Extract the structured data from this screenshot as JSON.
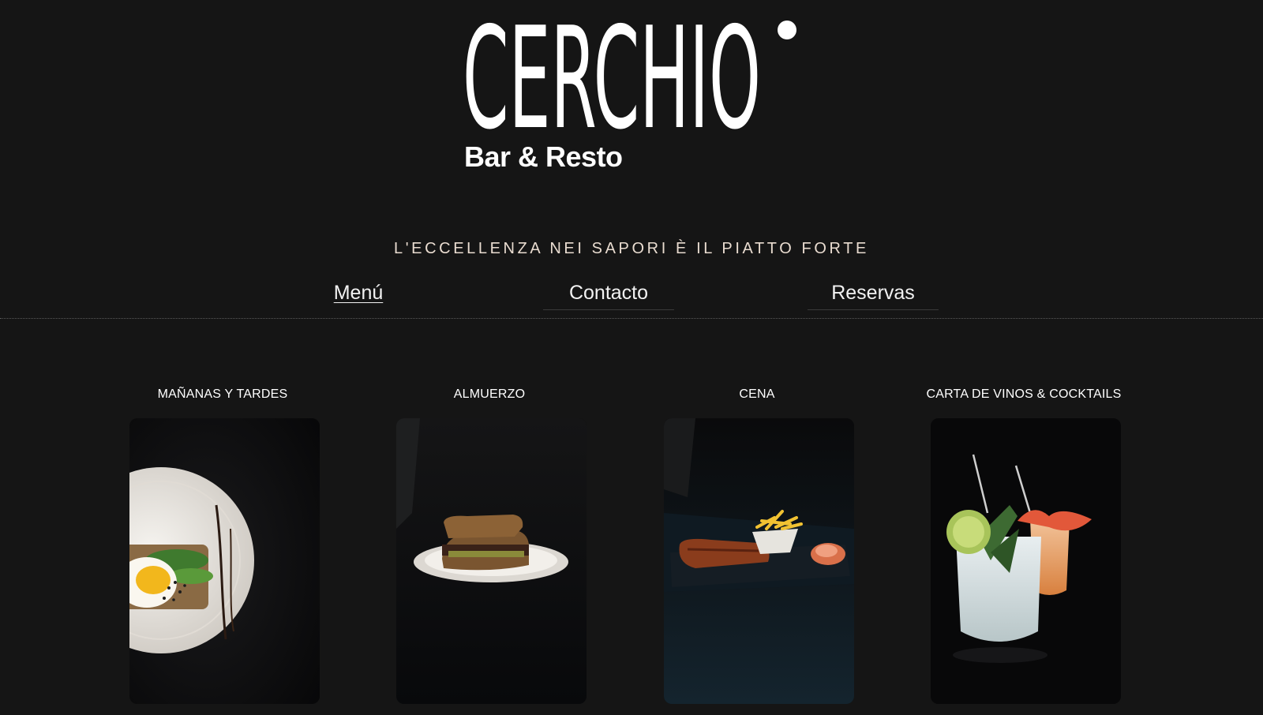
{
  "brand": {
    "name": "CERCHIO",
    "subtitle": "Bar & Resto"
  },
  "tagline": "L'ECCELLENZA NEI SAPORI È IL PIATTO FORTE",
  "nav": {
    "menu": "Menú",
    "contacto": "Contacto",
    "reservas": "Reservas"
  },
  "cards": [
    {
      "title": "MAÑANAS Y TARDES",
      "image": "egg-avocado-toast-photo"
    },
    {
      "title": "ALMUERZO",
      "image": "sandwich-photo"
    },
    {
      "title": "CENA",
      "image": "ribs-and-fries-photo"
    },
    {
      "title": "CARTA DE VINOS & COCKTAILS",
      "image": "cocktails-photo"
    }
  ],
  "colors": {
    "background": "#151515",
    "text": "#ffffff",
    "tagline": "#e9dcd0"
  }
}
